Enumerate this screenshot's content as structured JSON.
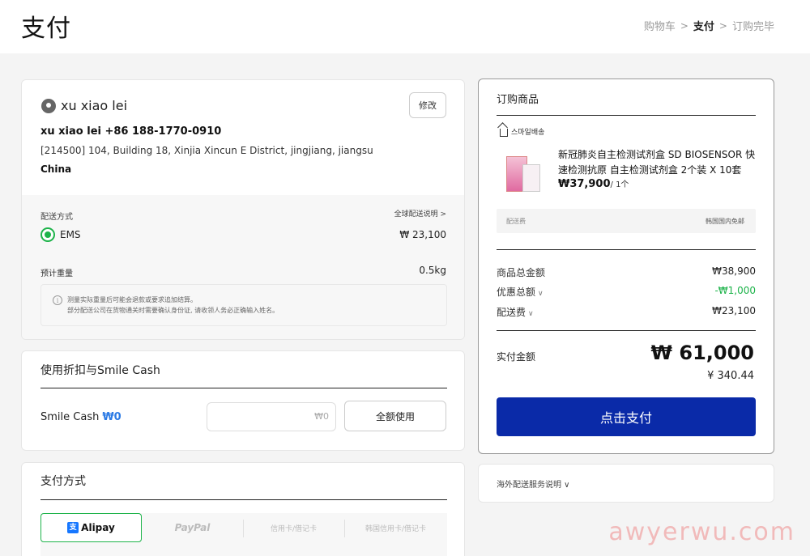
{
  "header": {
    "title": "支付",
    "breadcrumb": {
      "cart": "购物车",
      "sep": ">",
      "pay": "支付",
      "done": "订购完毕"
    }
  },
  "address": {
    "name": "xu xiao lei",
    "edit_label": "修改",
    "line1": "xu xiao lei +86 188-1770-0910",
    "line2": "[214500] 104, Building 18, Xinjia Xincun E District, jingjiang, jiangsu",
    "line3": "China"
  },
  "shipping": {
    "label": "配送方式",
    "link": "全球配送说明 >",
    "method": "EMS",
    "price": "₩ 23,100",
    "weight_label": "预计重量",
    "weight": "0.5kg",
    "notice_icon": "i",
    "notice1": "测量实际重量后可能会退款或要求追加结算。",
    "notice2": "部分配送公司在货物通关时需要确认身份证, 请收领人务必正确输入姓名。"
  },
  "discount": {
    "title": "使用折扣与Smile Cash",
    "smile_label": "Smile Cash",
    "smile_value": "₩0",
    "input_value": "₩0",
    "use_all_label": "全额使用"
  },
  "payment": {
    "title": "支付方式",
    "tabs": {
      "alipay": "Alipay",
      "alipay_icon": "支",
      "paypal": "PayPal",
      "credit": "信用卡/借记卡",
      "kr_credit": "韩国信用卡/借记卡"
    }
  },
  "order": {
    "title": "订购商品",
    "seller": "스마일배송",
    "product_name": "新冠肺炎自主检测试剂盒 SD BIOSENSOR 快速检测抗原 自主检测试剂盒 2个装 X 10套",
    "price": "₩37,900",
    "qty": "/ 1个",
    "ship_fee_label": "配送费",
    "ship_fee_value": "韩国国内免邮",
    "total_label": "商品总金额",
    "total": "₩38,900",
    "discount_label": "优惠总额",
    "discount": "-₩1,000",
    "delivery_label": "配送费",
    "delivery": "₩23,100",
    "chev": "∨",
    "pay_label": "实付金额",
    "pay_amount": "₩ 61,000",
    "pay_cny": "¥ 340.44",
    "pay_button": "点击支付"
  },
  "overseas": {
    "label": "海外配送服务说明 ∨"
  },
  "watermark": "awyerwu.com",
  "colors": {
    "accent": "#0a2aa8",
    "green": "#1db34a",
    "blue": "#2c7be5"
  }
}
